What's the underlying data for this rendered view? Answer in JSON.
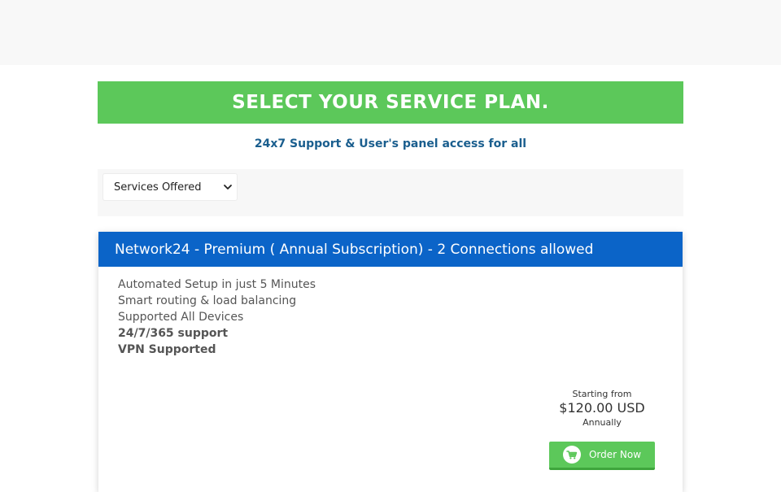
{
  "banner": {
    "title": "SELECT YOUR SERVICE PLAN."
  },
  "tagline": "24x7 Support & User's panel access for all",
  "filter": {
    "selected": "Services Offered"
  },
  "plan": {
    "title": "Network24 - Premium ( Annual Subscription) - 2 Connections allowed",
    "features": [
      {
        "text": "Automated Setup in just 5 Minutes",
        "bold": false
      },
      {
        "text": "Smart routing & load balancing",
        "bold": false
      },
      {
        "text": "Supported All Devices",
        "bold": false
      },
      {
        "text": "24/7/365 support",
        "bold": true
      },
      {
        "text": "VPN Supported",
        "bold": true
      }
    ],
    "price": {
      "prefix": "Starting from",
      "amount": "$120.00 USD",
      "cycle": "Annually"
    },
    "order_label": "Order Now",
    "order_icon": "shopping-cart-icon"
  },
  "colors": {
    "banner_green": "#5cc85a",
    "header_blue": "#0b64c8",
    "tagline_blue": "#1a5e8e"
  }
}
